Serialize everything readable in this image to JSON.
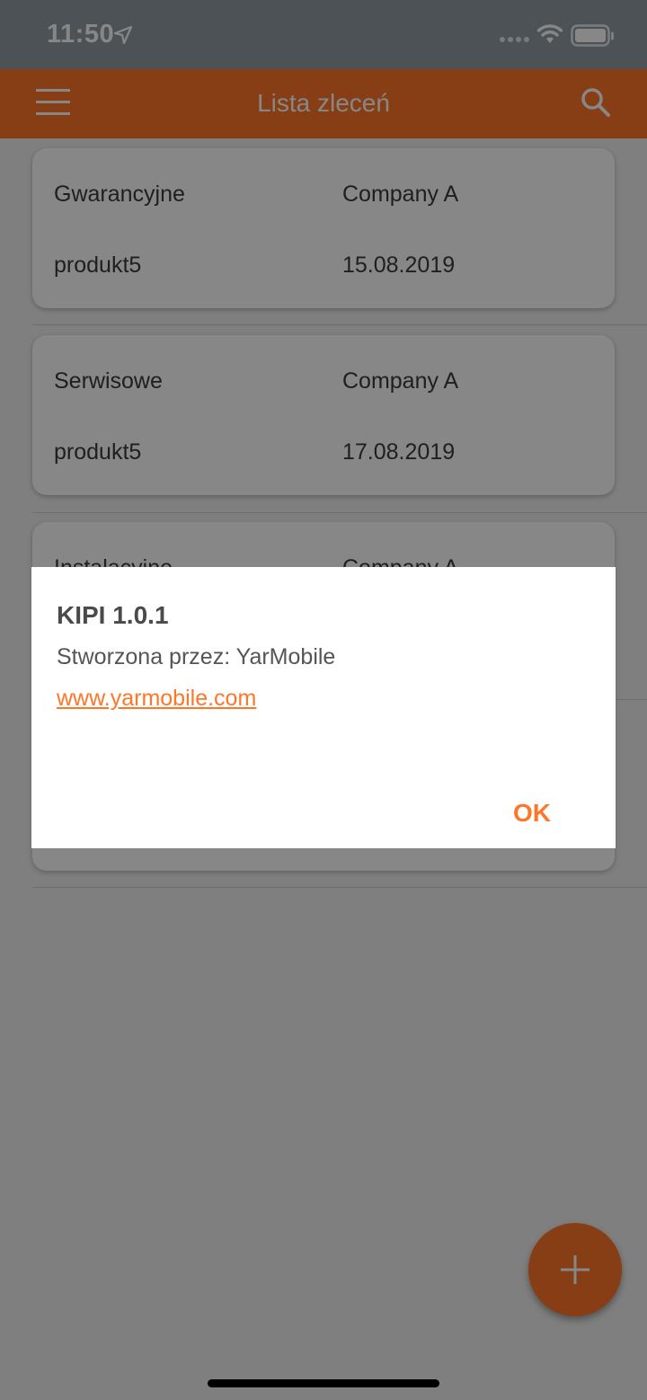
{
  "status_bar": {
    "time": "11:50",
    "icons": [
      "location-arrow-icon",
      "signal-icon",
      "wifi-icon",
      "battery-icon"
    ]
  },
  "app_bar": {
    "title": "Lista zleceń",
    "menu_icon": "menu-icon",
    "search_icon": "search-icon",
    "color": "#ff7629"
  },
  "orders": [
    {
      "type": "Gwarancyjne",
      "company": "Company A",
      "product": "produkt5",
      "date": "15.08.2019"
    },
    {
      "type": "Serwisowe",
      "company": "Company A",
      "product": "produkt5",
      "date": "17.08.2019"
    },
    {
      "type": "Instalacyjne",
      "company": "Company A",
      "product": "",
      "date": ""
    }
  ],
  "dialog": {
    "title": "KIPI 1.0.1",
    "body": "Stworzona przez: YarMobile",
    "link": "www.yarmobile.com",
    "ok_label": "OK"
  },
  "fab": {
    "icon": "plus-icon"
  },
  "colors": {
    "accent": "#ff7629",
    "status_bar": "#919ba3",
    "scrim": "rgba(0,0,0,0.47)"
  }
}
